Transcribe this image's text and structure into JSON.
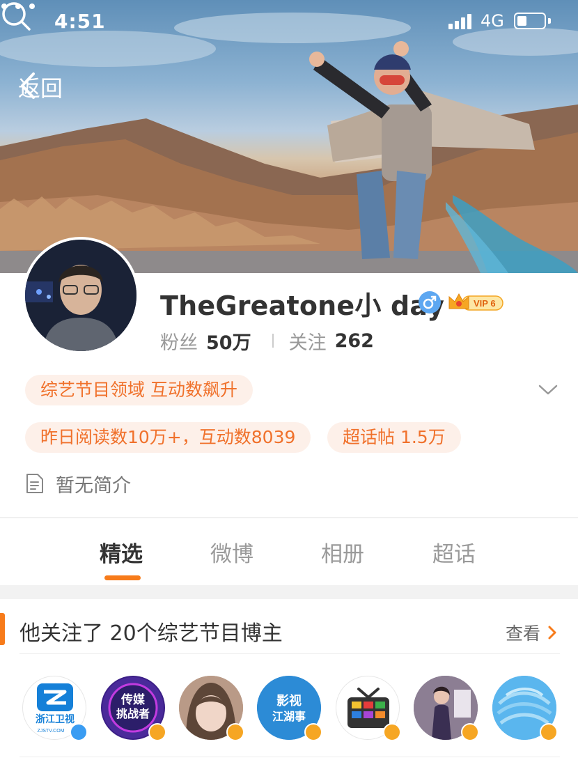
{
  "status_bar": {
    "time": "4:51",
    "network": "4G",
    "battery_level": 0.35
  },
  "nav": {
    "back_label": "返回",
    "search_icon": "search-icon",
    "more_icon": "more-icon"
  },
  "profile": {
    "name": "TheGreatone小 day",
    "gender_icon": "male-icon",
    "vip_label": "VIP 6",
    "followers_label": "粉丝",
    "followers_count": "50万",
    "following_label": "关注",
    "following_count": "262"
  },
  "tags": [
    {
      "label": "综艺节目领域 互动数飙升"
    },
    {
      "label": "昨日阅读数10万+，互动数8039"
    },
    {
      "label": "超话帖 1.5万"
    }
  ],
  "bio": {
    "text": "暂无简介"
  },
  "tabs": [
    {
      "label": "精选",
      "active": true
    },
    {
      "label": "微博",
      "active": false
    },
    {
      "label": "相册",
      "active": false
    },
    {
      "label": "超话",
      "active": false
    }
  ],
  "followed_section": {
    "title": "他关注了 20个综艺节目博主",
    "more_label": "查看",
    "avatars": [
      {
        "name": "zhejiang-tv",
        "badge_text_1": "浙江卫视",
        "badge_text_2": "ZJSTV.COM",
        "verify": "blue"
      },
      {
        "name": "media-challenger",
        "badge_text_1": "传媒",
        "badge_text_2": "挑战者",
        "verify": "orange"
      },
      {
        "name": "woman-portrait-1",
        "verify": "orange"
      },
      {
        "name": "film-jianghu",
        "badge_text_1": "影视",
        "badge_text_2": "江湖事",
        "verify": "orange"
      },
      {
        "name": "tv-icon",
        "verify": "orange"
      },
      {
        "name": "woman-portrait-2",
        "verify": "orange"
      },
      {
        "name": "blue-swirl",
        "verify": "orange"
      }
    ]
  },
  "colors": {
    "accent": "#f77b1a",
    "tag_bg": "#fdf0e9",
    "tag_text": "#f0712b",
    "verify_blue": "#3a9cf2",
    "verify_orange": "#f6a623"
  }
}
